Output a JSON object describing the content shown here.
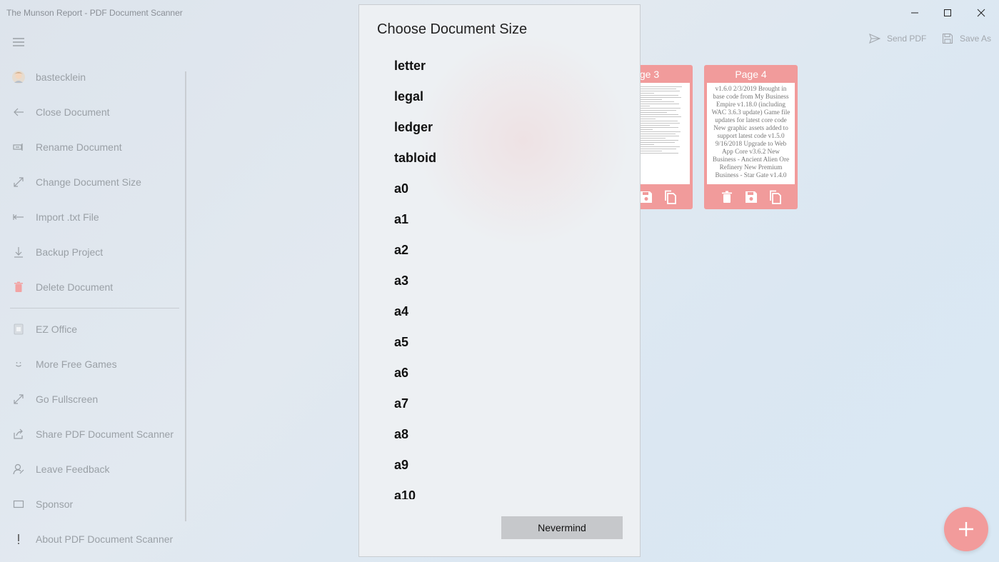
{
  "window": {
    "title": "The Munson Report - PDF Document Scanner",
    "controls": [
      "minimize-icon",
      "maximize-icon",
      "close-icon"
    ]
  },
  "sidebar": {
    "user": "bastecklein",
    "items": [
      {
        "label": "Close Document",
        "icon": "arrow-left-icon"
      },
      {
        "label": "Rename Document",
        "icon": "rename-icon"
      },
      {
        "label": "Change Document Size",
        "icon": "resize-icon"
      },
      {
        "label": "Import .txt File",
        "icon": "import-icon"
      },
      {
        "label": "Backup Project",
        "icon": "download-icon"
      },
      {
        "label": "Delete Document",
        "icon": "trash-icon"
      },
      {
        "label": "EZ Office",
        "icon": "ez-office-icon"
      },
      {
        "label": "More Free Games",
        "icon": "smile-icon"
      },
      {
        "label": "Go Fullscreen",
        "icon": "fullscreen-icon"
      },
      {
        "label": "Share PDF Document Scanner",
        "icon": "share-icon"
      },
      {
        "label": "Leave Feedback",
        "icon": "feedback-icon"
      },
      {
        "label": "Sponsor",
        "icon": "sponsor-icon"
      },
      {
        "label": "About PDF Document Scanner",
        "icon": "info-icon"
      }
    ]
  },
  "commands": {
    "send_pdf": "Send PDF",
    "save_as": "Save As"
  },
  "pages": [
    {
      "title": "ge 3",
      "text": ""
    },
    {
      "title": "Page 4",
      "text": "v1.6.0 2/3/2019 Brought in base code from My Business Empire v1.18.0 (including WAC 3.6.3 update) Game file updates for latest core code New graphic assets added to support latest code v1.5.0 9/16/2018 Upgrade to Web App Core v3.6.2 New Business - Ancient Alien Ore Refinery New Premium Business - Star Gate v1.4.0"
    }
  ],
  "dialog": {
    "title": "Choose Document Size",
    "options": [
      "letter",
      "legal",
      "ledger",
      "tabloid",
      "a0",
      "a1",
      "a2",
      "a3",
      "a4",
      "a5",
      "a6",
      "a7",
      "a8",
      "a9",
      "a10"
    ],
    "nevermind_label": "Nevermind"
  },
  "colors": {
    "accent": "#f19b9b",
    "sidebar_text": "#9aa0a6",
    "delete_icon": "#f2a3a3"
  }
}
